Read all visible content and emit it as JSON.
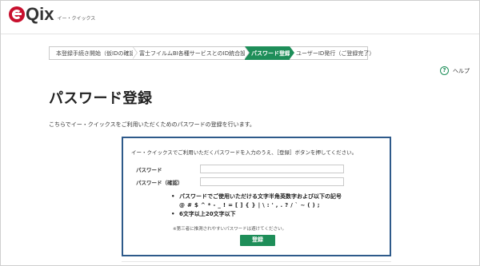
{
  "header": {
    "logo_text": "Qix",
    "logo_sub": "イー・クイックス"
  },
  "steps": [
    {
      "label": "本登録手続き開始（仮IDの確認）",
      "active": false
    },
    {
      "label": "富士フイルムBI各種サービスとのID統合設定",
      "active": false
    },
    {
      "label": "パスワード登録",
      "active": true
    },
    {
      "label": "ユーザーID発行（ご登録完了）",
      "active": false
    }
  ],
  "help": {
    "label": "ヘルプ",
    "icon": "question-icon"
  },
  "page": {
    "title": "パスワード登録",
    "intro": "こちらでイー・クイックスをご利用いただくためのパスワードの登録を行います。"
  },
  "form": {
    "description": "イー・クイックスでご利用いただくパスワードを入力のうえ、［登録］ボタンを押してください。",
    "password_label": "パスワード",
    "password_value": "",
    "confirm_label": "パスワード（確認）",
    "confirm_value": "",
    "rule1": "パスワードでご使用いただける文字半角英数字および以下の記号",
    "rule_symbols": "@ # $ ^ * - _ ! = [ ] { } | \\ : ' , . ? / ` ~ ( ) ;",
    "rule2": "6文字以上20文字以下",
    "note": "※第三者に推測されやすいパスワードは避けてください。",
    "submit_label": "登録"
  },
  "colors": {
    "accent": "#1e8e59",
    "card_border": "#2e5a8a",
    "logo": "#c8102e"
  }
}
